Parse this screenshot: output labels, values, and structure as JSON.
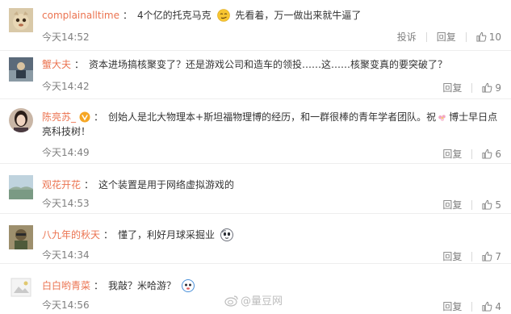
{
  "comments": [
    {
      "username": "complainalltime",
      "text": "4个亿的托克马克",
      "text_after_emoji": "先看着，万一做出来就牛逼了",
      "time": "今天14:52",
      "report_label": "投诉",
      "reply_label": "回复",
      "likes": "10"
    },
    {
      "username": "蟹大夫",
      "text": "资本进场搞核聚变了？还是游戏公司和造车的领投……这……核聚变真的要突破了？",
      "time": "今天14:42",
      "reply_label": "回复",
      "likes": "9"
    },
    {
      "username": "陈亮苏_",
      "text": "创始人是北大物理本+斯坦福物理博的经历，和一群很棒的青年学者团队。祝",
      "text_after_emoji": "博士早日点亮科技树！",
      "time": "今天14:49",
      "reply_label": "回复",
      "likes": "6"
    },
    {
      "username": "观花开花",
      "text": "这个装置是用于网络虚拟游戏的",
      "time": "今天14:53",
      "reply_label": "回复",
      "likes": "5"
    },
    {
      "username": "八九年的秋天",
      "text": "懂了，利好月球采掘业",
      "time": "今天14:34",
      "reply_label": "回复",
      "likes": "7"
    },
    {
      "username": "白白哟青菜",
      "text": "我敲？米哈游？",
      "time": "今天14:56",
      "reply_label": "回复",
      "likes": "4"
    }
  ],
  "colon": "：",
  "watermark": "@量豆网",
  "colors": {
    "username": "#eb7350",
    "meta": "#808080",
    "verified": "#f6a623"
  },
  "icons": [
    "thumbs-up-icon",
    "verified-badge-icon",
    "smirk-emoji",
    "doge-emoji",
    "weibo-logo-icon"
  ]
}
